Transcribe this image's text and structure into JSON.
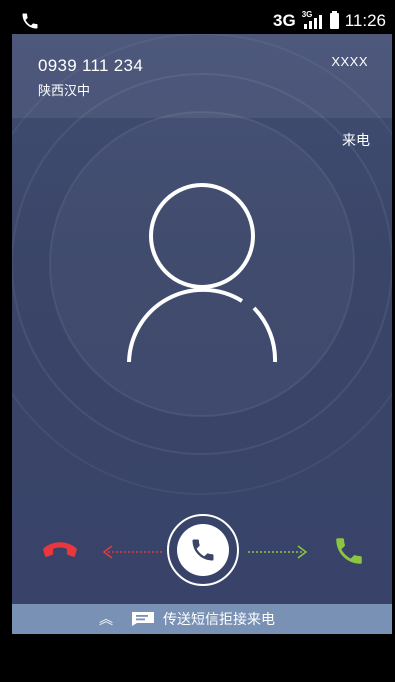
{
  "status_bar": {
    "network": "3G",
    "signal_badge": "3G",
    "time": "11:26",
    "signal_level": 4,
    "battery_level": 1.0
  },
  "call": {
    "number": "0939 111 234",
    "location": "陕西汉中",
    "sim_label": "XXXX",
    "status": "来电"
  },
  "actions": {
    "decline_icon": "hangup-icon",
    "answer_icon": "phone-icon",
    "accept_icon": "phone-answer-icon",
    "decline_color": "#e8383d",
    "accept_color": "#8cc63f"
  },
  "sms_bar": {
    "label": "传送短信拒接来电",
    "chevron": "︽"
  },
  "colors": {
    "background": "#3a4568",
    "sms_bar": "#7891b5"
  }
}
